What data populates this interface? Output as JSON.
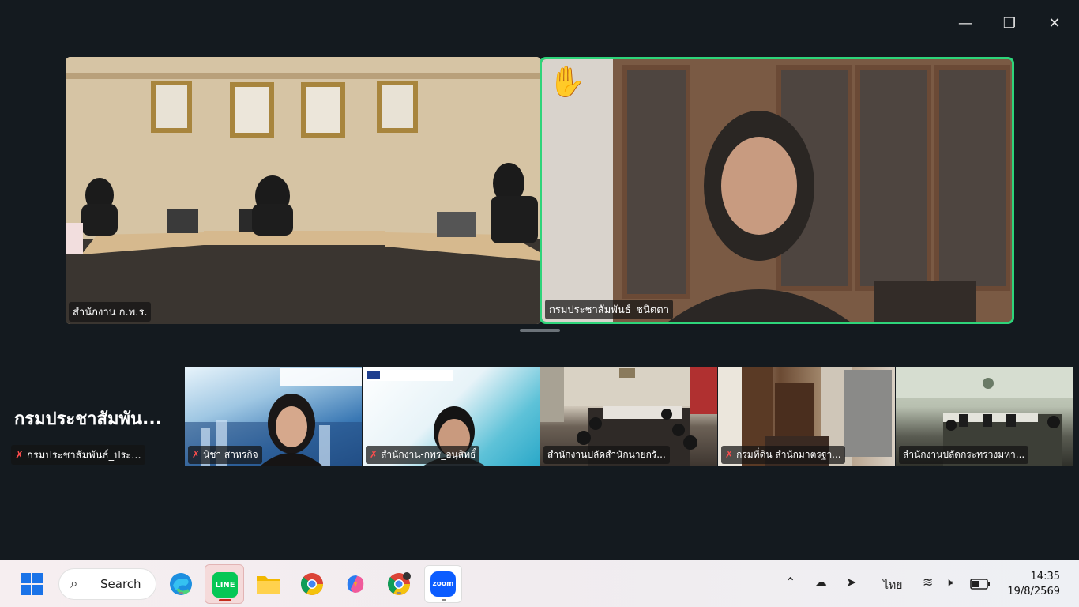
{
  "window_controls": {
    "minimize": "—",
    "restore": "❐",
    "close": "✕"
  },
  "main_tiles": {
    "left_name": "สำนักงาน ก.พ.ร.",
    "right_name": "กรมประชาสัมพันธ์_ชนิตตา",
    "hand_emoji": "✋"
  },
  "thumbnails": {
    "big_name": "กรมประชาสัมพัน...",
    "name0": "กรมประชาสัมพันธ์_ประ...",
    "name1": "นิชา สาหรกิจ",
    "name2": "สำนักงาน-กพร_อนุสิทธิ์",
    "name3": "สำนักงานปลัดสำนักนายกรั...",
    "name4": "กรมที่ดิน สำนักมาตรฐา...",
    "name5": "สำนักงานปลัดกระทรวงมหา...",
    "mute_icon": "✗"
  },
  "taskbar": {
    "search_label": "Search",
    "line_label": "LINE",
    "zoom_label": "zoom",
    "language": "ไทย",
    "time": "14:35",
    "date": "19/8/2569"
  }
}
